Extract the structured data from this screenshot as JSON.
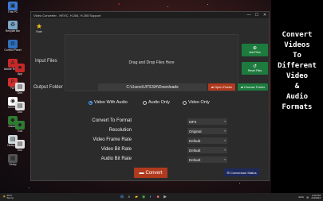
{
  "window": {
    "title": "Video Converter - HEVC, H.264, H.265 Support",
    "controls": {
      "minimize": "—",
      "maximize": "☐",
      "close": "✕"
    }
  },
  "rate": {
    "label": "Rate",
    "icon": "star-icon"
  },
  "input": {
    "label": "Input Files",
    "drop_text": "Drag and Drop Files Here",
    "add_label": "Add Files",
    "reset_label": "Reset Files"
  },
  "output": {
    "label": "Output Folder",
    "path": "C:\\Users\\UITESH\\Downloads",
    "open_label": "Open Folder",
    "choose_label": "Choose Folder"
  },
  "modes": {
    "options": [
      "Video With Audio",
      "Audio Only",
      "Video Only"
    ],
    "selected": "Video With Audio"
  },
  "settings": [
    {
      "label": "Convert To Format",
      "value": "MP4"
    },
    {
      "label": "Resolution",
      "value": "Original"
    },
    {
      "label": "Video Frame Rate",
      "value": "Default"
    },
    {
      "label": "Video Bit Rate",
      "value": "Default"
    },
    {
      "label": "Audio Bit Rate",
      "value": "Default"
    }
  ],
  "actions": {
    "convert": "Convert",
    "status": "Conversion Status"
  },
  "caption": "Convert\nVideos\nTo\nDifferent\nVideo\n&\nAudio\nFormats",
  "desktop_icons": [
    {
      "label": "This PC",
      "color": "#3a7bd5",
      "glyph": "▣"
    },
    {
      "label": "Recycle Bin",
      "color": "#7aa7c7",
      "glyph": "♻"
    },
    {
      "label": "Control Panel",
      "color": "#2e6fbf",
      "glyph": "⚙"
    },
    {
      "label": "Adobe Reader",
      "color": "#c62828",
      "glyph": "A"
    },
    {
      "label": "PDF",
      "color": "#d32f2f",
      "glyph": "P"
    },
    {
      "label": "Chrome",
      "color": "#ffffff",
      "glyph": "◉"
    },
    {
      "label": "Games",
      "color": "#2e7d32",
      "glyph": "◆"
    },
    {
      "label": "Notepad",
      "color": "#cfd8dc",
      "glyph": "▤"
    },
    {
      "label": "Setup",
      "color": "#555555",
      "glyph": "▦"
    }
  ],
  "desktop_icons_2": [
    {
      "label": "App",
      "color": "#c62828",
      "glyph": "■"
    },
    {
      "label": "Doc",
      "color": "#e0e0e0",
      "glyph": "▤"
    },
    {
      "label": "Doc",
      "color": "#e0e0e0",
      "glyph": "▤"
    },
    {
      "label": "Tool",
      "color": "#2e7d32",
      "glyph": "◆"
    },
    {
      "label": "Doc",
      "color": "#e0e0e0",
      "glyph": "▤"
    }
  ],
  "taskbar": {
    "weather_temp": "29°C",
    "weather_desc": "Sunny",
    "time": "3:26 PM",
    "date": "2/3/2024",
    "lang": "ENG"
  }
}
